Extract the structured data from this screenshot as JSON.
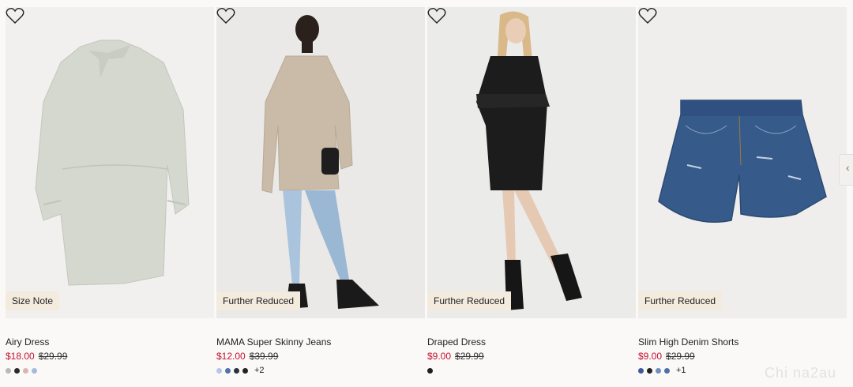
{
  "products": [
    {
      "name": "Airy Dress",
      "badge": "Size Note",
      "price": "$18.00",
      "old_price": "$29.99",
      "swatches": [
        "#b9bab4",
        "#2b2b2b",
        "#d9b6b0",
        "#a9b9d9"
      ],
      "more": ""
    },
    {
      "name": "MAMA Super Skinny Jeans",
      "badge": "Further Reduced",
      "price": "$12.00",
      "old_price": "$39.99",
      "swatches": [
        "#b6c6e2",
        "#5570a8",
        "#2a3142",
        "#222222"
      ],
      "more": "+2"
    },
    {
      "name": "Draped Dress",
      "badge": "Further Reduced",
      "price": "$9.00",
      "old_price": "$29.99",
      "swatches": [
        "#1f1f1f"
      ],
      "more": ""
    },
    {
      "name": "Slim High Denim Shorts",
      "badge": "Further Reduced",
      "price": "$9.00",
      "old_price": "$29.99",
      "swatches": [
        "#3e5a96",
        "#222222",
        "#6f8fbd",
        "#4e6fa6"
      ],
      "more": "+1"
    }
  ],
  "carousel": {
    "next_glyph": "‹"
  },
  "watermark": "Chi na2au"
}
